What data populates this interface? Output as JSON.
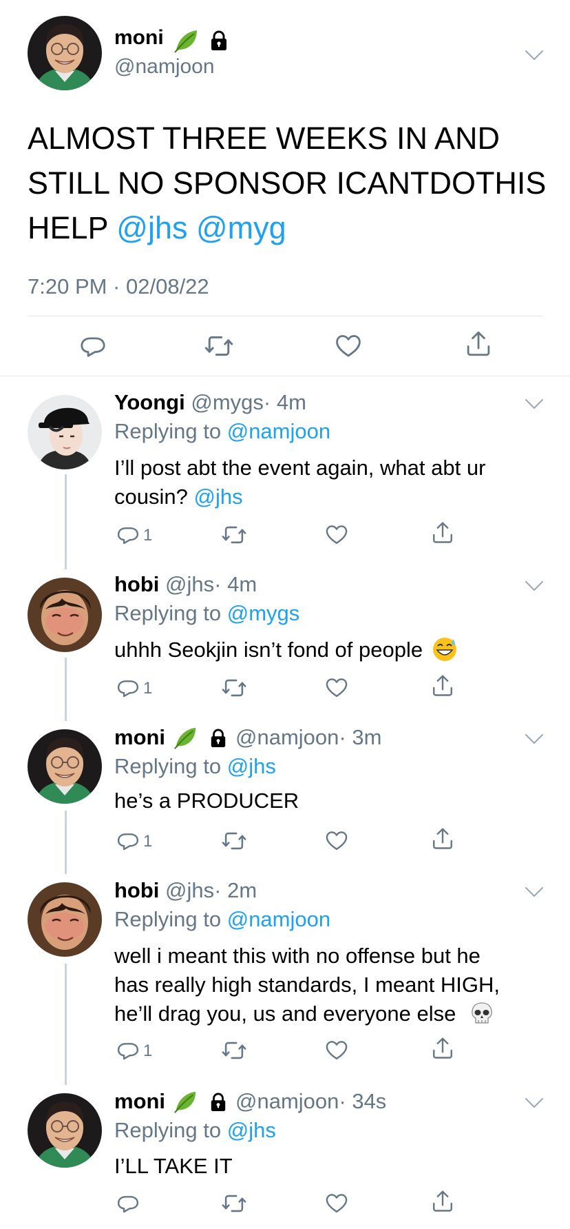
{
  "main_tweet": {
    "name": "moni",
    "handle": "@namjoon",
    "text_plain": "ALMOST THREE WEEKS IN AND\nSTILL NO SPONSOR ICANTDOTHIS\nHELP",
    "line1": "ALMOST THREE WEEKS IN AND",
    "line2": "STILL NO SPONSOR ICANTDOTHIS",
    "line3": "HELP",
    "mention1": "@jhs",
    "mention2": "@myg",
    "timestamp": "7:20 PM · 02/08/22"
  },
  "replies": [
    {
      "name": "Yoongi",
      "handle": "@mygs",
      "time": "· 4m",
      "replying_prefix": "Replying to",
      "replying_to": "@namjoon",
      "line1": "I’ll post abt the event again, what abt ur",
      "line2": "cousin?",
      "mention": "@jhs",
      "reply_count": "1"
    },
    {
      "name": "hobi",
      "handle": "@jhs",
      "time": "· 4m",
      "replying_prefix": "Replying to",
      "replying_to": "@mygs",
      "line1": "uhhh Seokjin isn’t fond of people",
      "reply_count": "1"
    },
    {
      "name": "moni",
      "handle": "@namjoon",
      "time": "· 3m",
      "replying_prefix": "Replying to",
      "replying_to": "@jhs",
      "line1": "he’s a PRODUCER",
      "reply_count": "1"
    },
    {
      "name": "hobi",
      "handle": "@jhs",
      "time": "· 2m",
      "replying_prefix": "Replying to",
      "replying_to": "@namjoon",
      "line1": "well i meant this with no offense but he",
      "line2": "has really high standards, I meant HIGH,",
      "line3": "he’ll drag you, us and everyone else",
      "reply_count": "1"
    },
    {
      "name": "moni",
      "handle": "@namjoon",
      "time": "· 34s",
      "replying_prefix": "Replying to",
      "replying_to": "@jhs",
      "line1": "I’LL TAKE IT"
    }
  ],
  "colors": {
    "link": "#1da1f2",
    "secondary": "#657786",
    "divider": "#e1e8ed",
    "thread": "#c9d3db"
  },
  "icons": [
    "reply-icon",
    "retweet-icon",
    "like-icon",
    "share-icon",
    "chevron-down-icon",
    "leaf-emoji",
    "lock-icon",
    "sweat-smile-emoji",
    "skull-emoji"
  ]
}
